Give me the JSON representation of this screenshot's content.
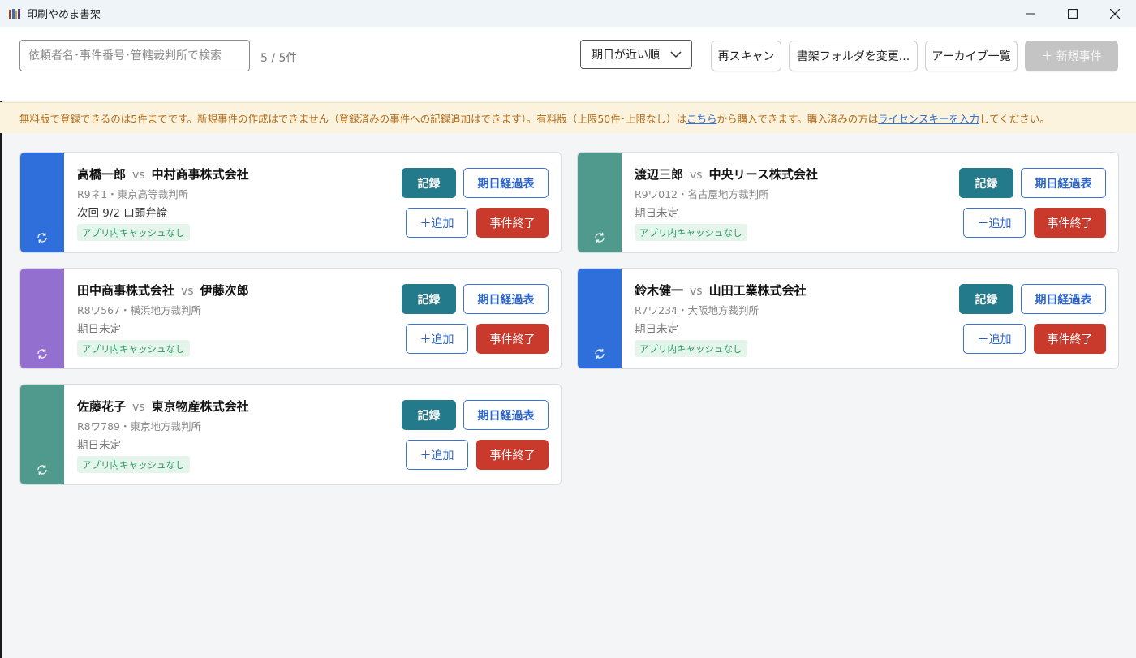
{
  "window": {
    "title": "印刷やめま書架"
  },
  "toolbar": {
    "search_placeholder": "依頼者名･事件番号･管轄裁判所で検索",
    "count": "5 / 5件",
    "sort_label": "期日が近い順",
    "rescan_label": "再スキャン",
    "change_folder_label": "書架フォルダを変更...",
    "archive_label": "アーカイブ一覧",
    "new_case_label": "＋ 新規事件"
  },
  "notice": {
    "text_1": "無料版で登録できるのは5件までです。新規事件の作成はできません（登録済みの事件への記録追加はできます）。有料版（上限50件･上限なし）は",
    "link_1": "こちら",
    "text_2": "から購入できます。購入済みの方は",
    "link_2": "ライセンスキーを入力",
    "text_3": "してください。"
  },
  "card_labels": {
    "vs": "vs",
    "record": "記録",
    "timeline": "期日経過表",
    "add": "＋追加",
    "close_case": "事件終了"
  },
  "cases": [
    {
      "client": "高橋一郎",
      "opponent": "中村商事株式会社",
      "meta": "R9ネ1・東京高等裁判所",
      "next": "次回 9/2 口頭弁論",
      "badge": "アプリ内キャッシュなし",
      "color": "#2f6fdb"
    },
    {
      "client": "渡辺三郎",
      "opponent": "中央リース株式会社",
      "meta": "R9ワ012・名古屋地方裁判所",
      "next": "期日未定",
      "badge": "アプリ内キャッシュなし",
      "color": "#4f9a8c"
    },
    {
      "client": "田中商事株式会社",
      "opponent": "伊藤次郎",
      "meta": "R8ワ567・横浜地方裁判所",
      "next": "期日未定",
      "badge": "アプリ内キャッシュなし",
      "color": "#9370cf"
    },
    {
      "client": "鈴木健一",
      "opponent": "山田工業株式会社",
      "meta": "R7ワ234・大阪地方裁判所",
      "next": "期日未定",
      "badge": "アプリ内キャッシュなし",
      "color": "#2f6fdb"
    },
    {
      "client": "佐藤花子",
      "opponent": "東京物産株式会社",
      "meta": "R8ワ789・東京地方裁判所",
      "next": "期日未定",
      "badge": "アプリ内キャッシュなし",
      "color": "#4f9a8c"
    }
  ],
  "icons": {
    "app": "bookshelf-icon",
    "minimize": "minimize-icon",
    "maximize": "maximize-icon",
    "close": "close-icon",
    "sort_dropdown": "chevron-down-icon",
    "sync": "sync-icon"
  }
}
